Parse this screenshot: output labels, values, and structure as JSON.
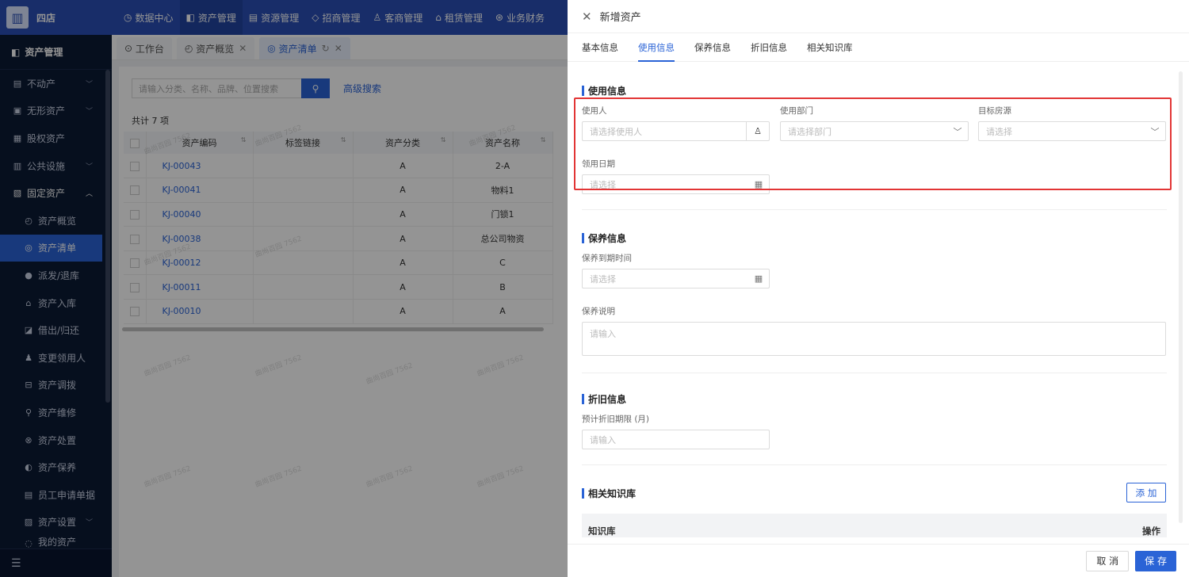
{
  "topnav": {
    "shop": "四店",
    "menu": [
      {
        "label": "数据中心",
        "icon": "◷"
      },
      {
        "label": "资产管理",
        "icon": "◧"
      },
      {
        "label": "资源管理",
        "icon": "▤"
      },
      {
        "label": "招商管理",
        "icon": "◇"
      },
      {
        "label": "客商管理",
        "icon": "♙"
      },
      {
        "label": "租赁管理",
        "icon": "⌂"
      },
      {
        "label": "业务财务",
        "icon": "⊛"
      }
    ]
  },
  "sidebar": {
    "title": "资产管理",
    "items": [
      {
        "label": "不动产",
        "icon": "▤"
      },
      {
        "label": "无形资产",
        "icon": "▣"
      },
      {
        "label": "股权资产",
        "icon": "▦"
      },
      {
        "label": "公共设施",
        "icon": "▥"
      },
      {
        "label": "固定资产",
        "icon": "▧"
      },
      {
        "label": "资产概览",
        "icon": "◴"
      },
      {
        "label": "资产清单",
        "icon": "◎"
      },
      {
        "label": "派发/退库",
        "icon": "●"
      },
      {
        "label": "资产入库",
        "icon": "⌂"
      },
      {
        "label": "借出/归还",
        "icon": "◪"
      },
      {
        "label": "变更领用人",
        "icon": "♟"
      },
      {
        "label": "资产调拨",
        "icon": "⊟"
      },
      {
        "label": "资产维修",
        "icon": "⚲"
      },
      {
        "label": "资产处置",
        "icon": "⊗"
      },
      {
        "label": "资产保养",
        "icon": "◐"
      },
      {
        "label": "员工申请单据",
        "icon": "▤"
      },
      {
        "label": "资产设置",
        "icon": "▨"
      },
      {
        "label": "我的资产",
        "icon": "◌"
      }
    ]
  },
  "tabs": [
    {
      "label": "工作台",
      "icon": "⊙"
    },
    {
      "label": "资产概览",
      "icon": "◴"
    },
    {
      "label": "资产清单",
      "icon": "◎"
    }
  ],
  "list": {
    "search_placeholder": "请输入分类、名称、品牌、位置搜索",
    "advanced_search": "高级搜索",
    "total": "共计 7 项",
    "columns": [
      "资产编码",
      "标签链接",
      "资产分类",
      "资产名称"
    ],
    "rows": [
      {
        "code": "KJ-00043",
        "link": "",
        "category": "A",
        "name": "2-A"
      },
      {
        "code": "KJ-00041",
        "link": "",
        "category": "A",
        "name": "物料1"
      },
      {
        "code": "KJ-00040",
        "link": "",
        "category": "A",
        "name": "门锁1"
      },
      {
        "code": "KJ-00038",
        "link": "",
        "category": "A",
        "name": "总公司物资"
      },
      {
        "code": "KJ-00012",
        "link": "",
        "category": "A",
        "name": "C"
      },
      {
        "code": "KJ-00011",
        "link": "",
        "category": "A",
        "name": "B"
      },
      {
        "code": "KJ-00010",
        "link": "",
        "category": "A",
        "name": "A"
      }
    ],
    "watermark": "曲尚百园 7562"
  },
  "drawer": {
    "title": "新增资产",
    "tabs": [
      "基本信息",
      "使用信息",
      "保养信息",
      "折旧信息",
      "相关知识库"
    ],
    "usage": {
      "title": "使用信息",
      "user_label": "使用人",
      "user_placeholder": "请选择使用人",
      "dept_label": "使用部门",
      "dept_placeholder": "请选择部门",
      "room_label": "目标房源",
      "room_placeholder": "请选择",
      "date_label": "领用日期",
      "date_placeholder": "请选择"
    },
    "maintenance": {
      "title": "保养信息",
      "expire_label": "保养到期时间",
      "expire_placeholder": "请选择",
      "desc_label": "保养说明",
      "desc_placeholder": "请输入"
    },
    "depreciation": {
      "title": "折旧信息",
      "period_label": "预计折旧期限 (月)",
      "period_placeholder": "请输入"
    },
    "knowledge": {
      "title": "相关知识库",
      "add": "添 加",
      "col_name": "知识库",
      "col_ops": "操作"
    },
    "cancel": "取 消",
    "save": "保 存"
  }
}
